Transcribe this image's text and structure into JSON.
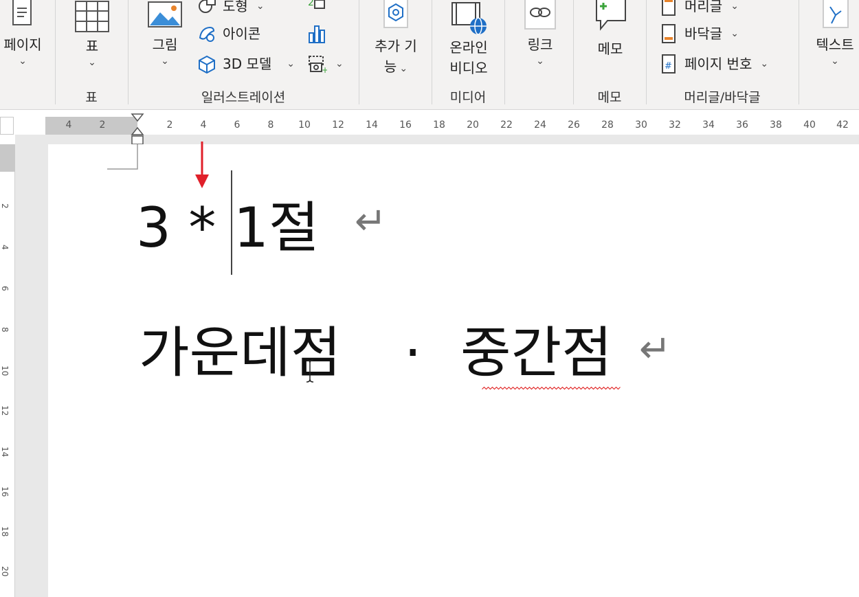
{
  "ribbon": {
    "page": {
      "label": "페이지"
    },
    "table": {
      "label": "표",
      "group_label": "표"
    },
    "illustrations": {
      "picture_label": "그림",
      "shapes_label": "도형",
      "icons_label": "아이콘",
      "model3d_label": "3D 모델",
      "group_label": "일러스트레이션"
    },
    "addins": {
      "label_line1": "추가 기",
      "label_line2": "능"
    },
    "media": {
      "label_line1": "온라인",
      "label_line2": "비디오",
      "group_label": "미디어"
    },
    "links": {
      "label": "링크"
    },
    "comments": {
      "label": "메모",
      "group_label": "메모"
    },
    "header_footer": {
      "header_label": "머리글",
      "footer_label": "바닥글",
      "page_number_label": "페이지 번호",
      "group_label": "머리글/바닥글"
    },
    "text": {
      "label": "텍스트"
    },
    "colors": {
      "blue": "#1f6fc6",
      "orange": "#e8842c",
      "green": "#3aa33a"
    }
  },
  "ruler": {
    "left_numbers": [
      "4",
      "2"
    ],
    "right_numbers": [
      "2",
      "4",
      "6",
      "8",
      "10",
      "12",
      "14",
      "16",
      "18",
      "20",
      "22",
      "24",
      "26",
      "28",
      "30",
      "32",
      "34",
      "36",
      "38",
      "40",
      "42"
    ],
    "vertical_numbers": [
      "2",
      "4",
      "6",
      "8",
      "10",
      "12",
      "14",
      "16",
      "18",
      "20"
    ]
  },
  "document": {
    "line1_before_caret": "3 *",
    "line1_after_caret": "1절",
    "line2_a": "가운데점",
    "line2_dot": "·",
    "line2_b": "중간점",
    "paragraph_mark": "↵",
    "annotation_color": "#e0202a",
    "spellcheck_color": "#e02020"
  }
}
